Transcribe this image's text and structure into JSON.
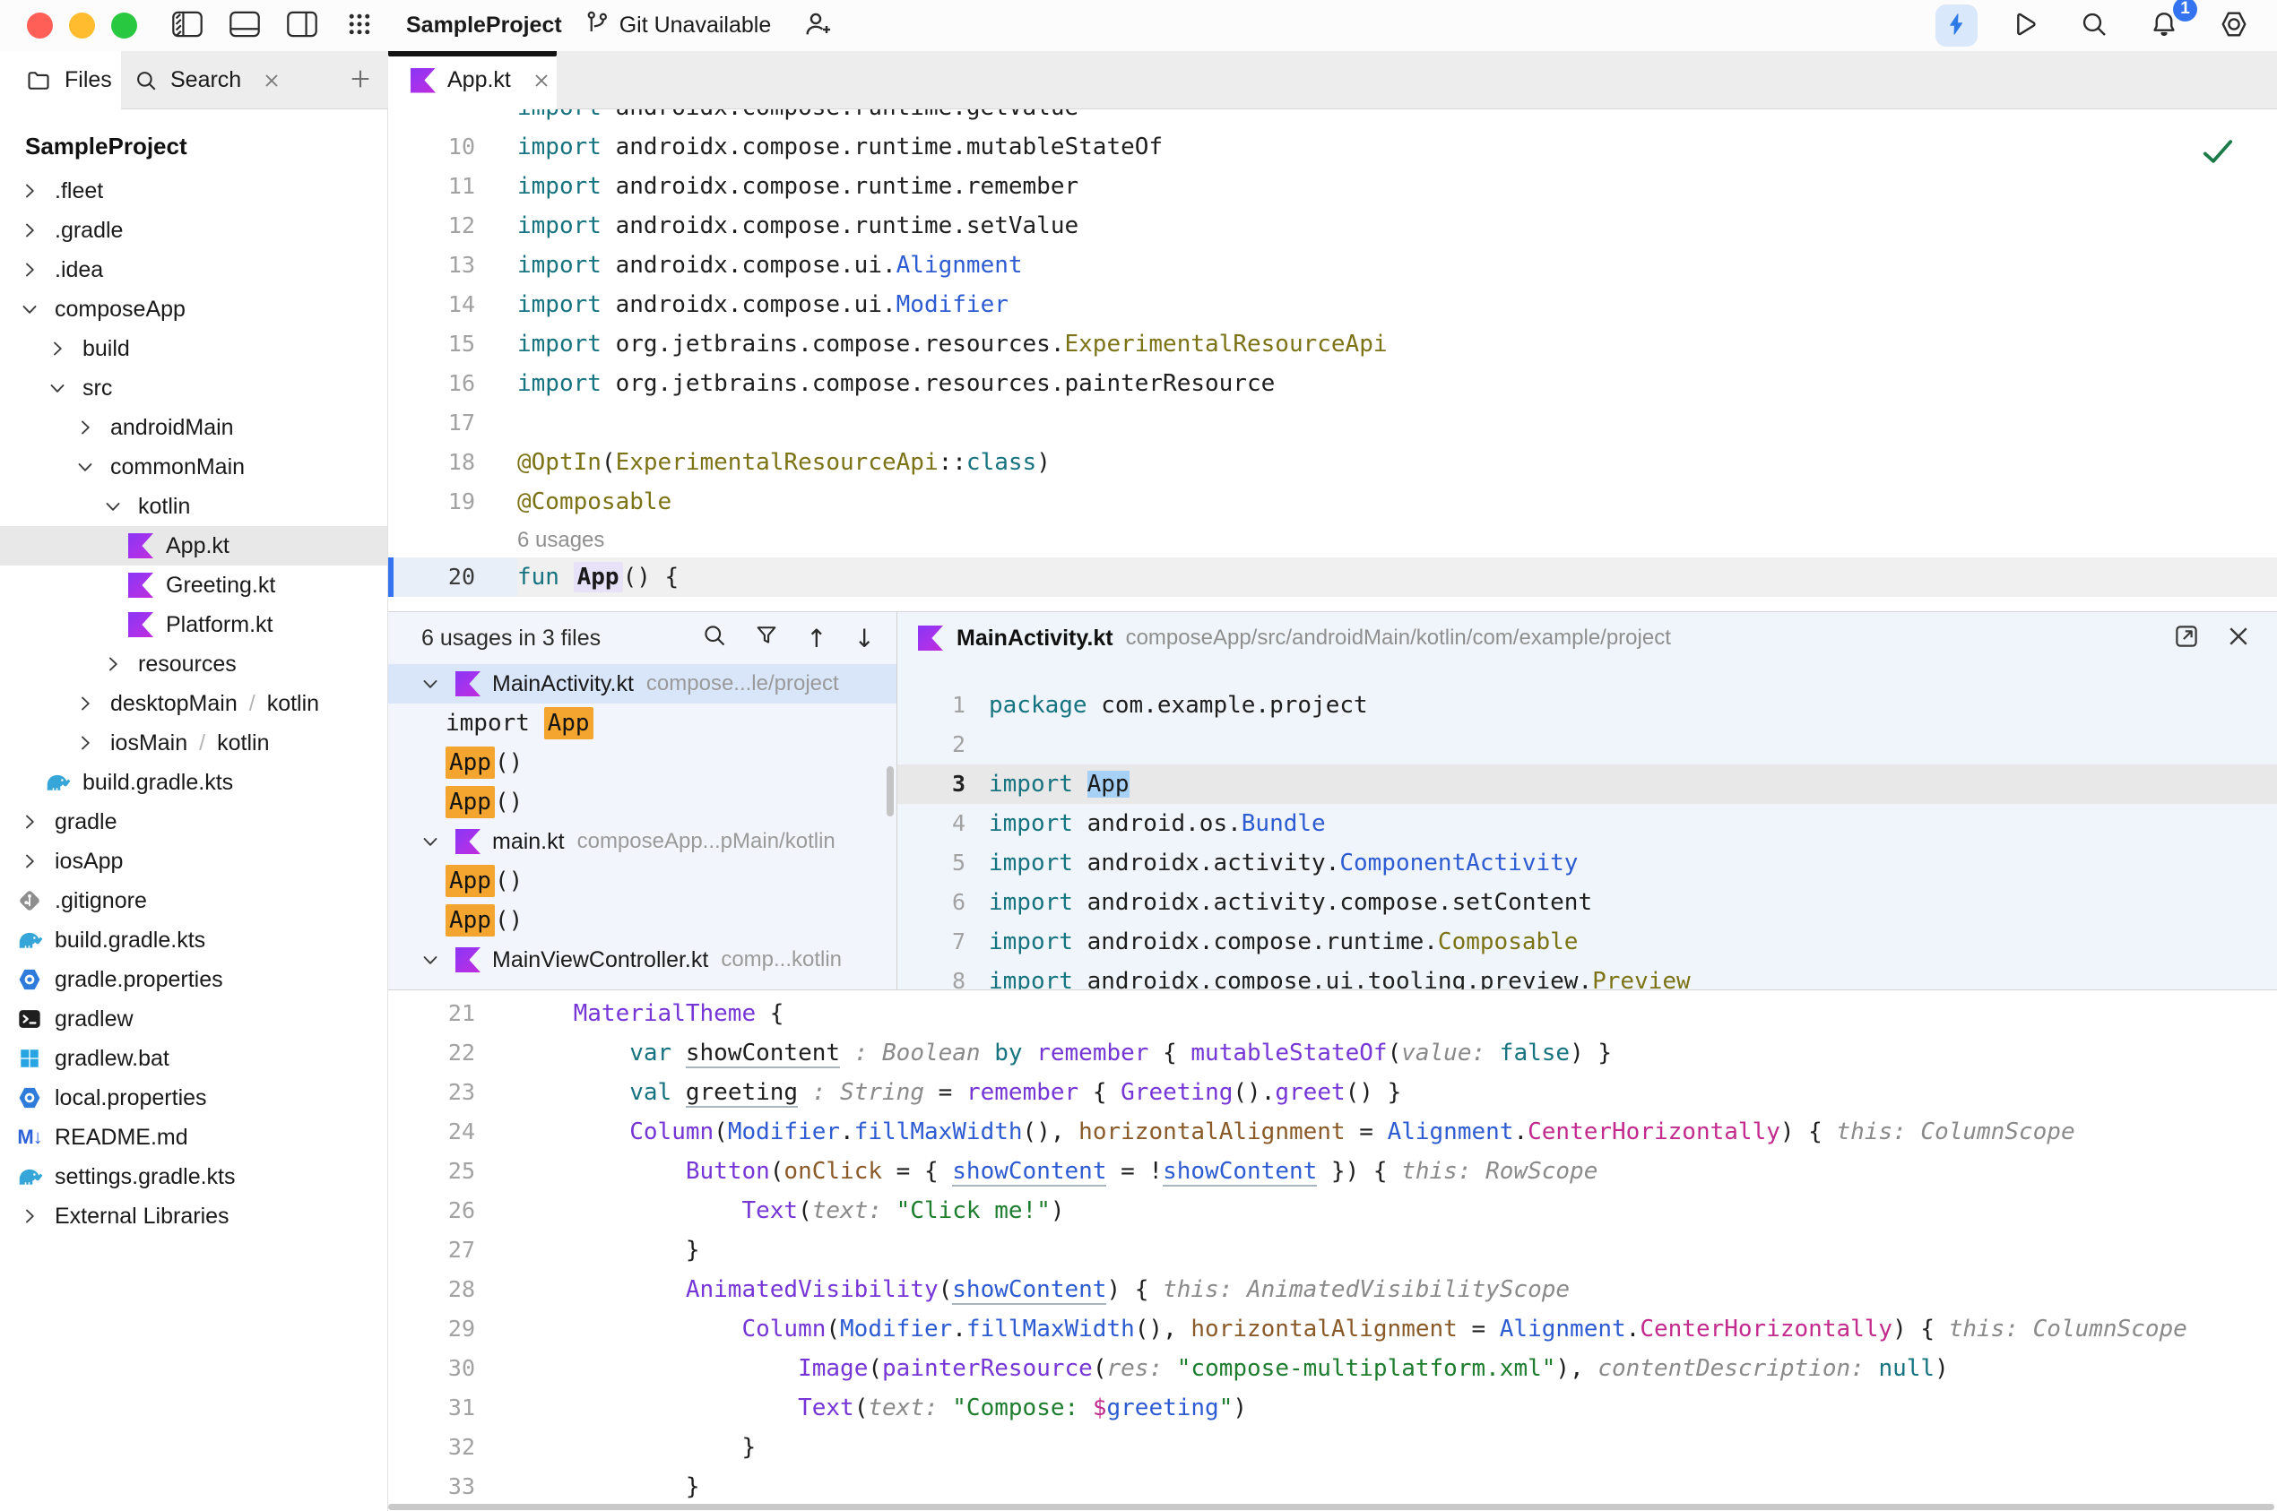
{
  "titlebar": {
    "project": "SampleProject",
    "git_status": "Git Unavailable",
    "notification_count": "1"
  },
  "sidebar": {
    "tabs": [
      {
        "label": "Files"
      },
      {
        "label": "Search"
      }
    ],
    "root": "SampleProject",
    "tree": [
      {
        "label": ".fleet",
        "indent": 0,
        "chevron": "right"
      },
      {
        "label": ".gradle",
        "indent": 0,
        "chevron": "right"
      },
      {
        "label": ".idea",
        "indent": 0,
        "chevron": "right"
      },
      {
        "label": "composeApp",
        "indent": 0,
        "chevron": "down"
      },
      {
        "label": "build",
        "indent": 1,
        "chevron": "right"
      },
      {
        "label": "src",
        "indent": 1,
        "chevron": "down"
      },
      {
        "label": "androidMain",
        "indent": 2,
        "chevron": "right"
      },
      {
        "label": "commonMain",
        "indent": 2,
        "chevron": "down"
      },
      {
        "label": "kotlin",
        "indent": 3,
        "chevron": "down"
      },
      {
        "label": "App.kt",
        "indent": 4,
        "icon": "kotlin",
        "selected": true
      },
      {
        "label": "Greeting.kt",
        "indent": 4,
        "icon": "kotlin"
      },
      {
        "label": "Platform.kt",
        "indent": 4,
        "icon": "kotlin"
      },
      {
        "label": "resources",
        "indent": 3,
        "chevron": "right"
      },
      {
        "label": "desktopMain",
        "suffix": "kotlin",
        "indent": 2,
        "chevron": "right"
      },
      {
        "label": "iosMain",
        "suffix": "kotlin",
        "indent": 2,
        "chevron": "right"
      },
      {
        "label": "build.gradle.kts",
        "indent": 1,
        "icon": "gradle"
      },
      {
        "label": "gradle",
        "indent": 0,
        "chevron": "right"
      },
      {
        "label": "iosApp",
        "indent": 0,
        "chevron": "right"
      },
      {
        "label": ".gitignore",
        "indent": 0,
        "icon": "git"
      },
      {
        "label": "build.gradle.kts",
        "indent": 0,
        "icon": "gradle"
      },
      {
        "label": "gradle.properties",
        "indent": 0,
        "icon": "properties"
      },
      {
        "label": "gradlew",
        "indent": 0,
        "icon": "terminal"
      },
      {
        "label": "gradlew.bat",
        "indent": 0,
        "icon": "windows"
      },
      {
        "label": "local.properties",
        "indent": 0,
        "icon": "properties"
      },
      {
        "label": "README.md",
        "indent": 0,
        "icon": "markdown"
      },
      {
        "label": "settings.gradle.kts",
        "indent": 0,
        "icon": "gradle"
      },
      {
        "label": "External Libraries",
        "indent": 0,
        "chevron": "right"
      }
    ]
  },
  "editor": {
    "tab_label": "App.kt",
    "top_lines": [
      {
        "n": "",
        "partial": true,
        "tokens": [
          {
            "t": "import",
            "s": "kw"
          },
          {
            "t": " androidx.compose.runtime.getValue",
            "s": "pl"
          }
        ]
      },
      {
        "n": "10",
        "tokens": [
          {
            "t": "import",
            "s": "kw"
          },
          {
            "t": " androidx.compose.runtime.mutableStateOf",
            "s": "pl"
          }
        ]
      },
      {
        "n": "11",
        "tokens": [
          {
            "t": "import",
            "s": "kw"
          },
          {
            "t": " androidx.compose.runtime.remember",
            "s": "pl"
          }
        ]
      },
      {
        "n": "12",
        "tokens": [
          {
            "t": "import",
            "s": "kw"
          },
          {
            "t": " androidx.compose.runtime.setValue",
            "s": "pl"
          }
        ]
      },
      {
        "n": "13",
        "tokens": [
          {
            "t": "import",
            "s": "kw"
          },
          {
            "t": " androidx.compose.ui.",
            "s": "pl"
          },
          {
            "t": "Alignment",
            "s": "cls"
          }
        ]
      },
      {
        "n": "14",
        "tokens": [
          {
            "t": "import",
            "s": "kw"
          },
          {
            "t": " androidx.compose.ui.",
            "s": "pl"
          },
          {
            "t": "Modifier",
            "s": "cls"
          }
        ]
      },
      {
        "n": "15",
        "tokens": [
          {
            "t": "import",
            "s": "kw"
          },
          {
            "t": " org.jetbrains.compose.resources.",
            "s": "pl"
          },
          {
            "t": "ExperimentalResourceApi",
            "s": "ann"
          }
        ]
      },
      {
        "n": "16",
        "tokens": [
          {
            "t": "import",
            "s": "kw"
          },
          {
            "t": " org.jetbrains.compose.resources.painterResource",
            "s": "pl"
          }
        ]
      },
      {
        "n": "17",
        "tokens": []
      },
      {
        "n": "18",
        "tokens": [
          {
            "t": "@OptIn",
            "s": "ann"
          },
          {
            "t": "(",
            "s": "pl"
          },
          {
            "t": "ExperimentalResourceApi",
            "s": "ann"
          },
          {
            "t": "::",
            "s": "pl"
          },
          {
            "t": "class",
            "s": "kw"
          },
          {
            "t": ")",
            "s": "pl"
          }
        ]
      },
      {
        "n": "19",
        "tokens": [
          {
            "t": "@Composable",
            "s": "ann"
          }
        ]
      },
      {
        "n": "20",
        "cur": true,
        "hint": "6 usages",
        "tokens": [
          {
            "t": "fun ",
            "s": "kw"
          },
          {
            "t": "App",
            "s": "hlapp"
          },
          {
            "t": "() {",
            "s": "pl"
          }
        ]
      }
    ],
    "bottom_lines": [
      {
        "n": "21",
        "tokens": [
          {
            "t": "    ",
            "s": "pl"
          },
          {
            "t": "MaterialTheme",
            "s": "fn"
          },
          {
            "t": " {",
            "s": "pl"
          }
        ]
      },
      {
        "n": "22",
        "tokens": [
          {
            "t": "        ",
            "s": "pl"
          },
          {
            "t": "var ",
            "s": "kw"
          },
          {
            "t": "showContent",
            "s": "decl"
          },
          {
            "t": " : Boolean ",
            "s": "hint"
          },
          {
            "t": "by ",
            "s": "kw"
          },
          {
            "t": "remember",
            "s": "fn"
          },
          {
            "t": " { ",
            "s": "pl"
          },
          {
            "t": "mutableStateOf",
            "s": "fn"
          },
          {
            "t": "(",
            "s": "pl"
          },
          {
            "t": "value: ",
            "s": "hint"
          },
          {
            "t": "false",
            "s": "kw"
          },
          {
            "t": ") }",
            "s": "pl"
          }
        ]
      },
      {
        "n": "23",
        "tokens": [
          {
            "t": "        ",
            "s": "pl"
          },
          {
            "t": "val ",
            "s": "kw"
          },
          {
            "t": "greeting",
            "s": "decl"
          },
          {
            "t": " : String ",
            "s": "hint"
          },
          {
            "t": "= ",
            "s": "pl"
          },
          {
            "t": "remember",
            "s": "fn"
          },
          {
            "t": " { ",
            "s": "pl"
          },
          {
            "t": "Greeting",
            "s": "fn"
          },
          {
            "t": "().",
            "s": "pl"
          },
          {
            "t": "greet",
            "s": "fn"
          },
          {
            "t": "() }",
            "s": "pl"
          }
        ]
      },
      {
        "n": "24",
        "tokens": [
          {
            "t": "        ",
            "s": "pl"
          },
          {
            "t": "Column",
            "s": "fn"
          },
          {
            "t": "(",
            "s": "pl"
          },
          {
            "t": "Modifier",
            "s": "cls"
          },
          {
            "t": ".",
            "s": "pl"
          },
          {
            "t": "fillMaxWidth",
            "s": "cls"
          },
          {
            "t": "(), ",
            "s": "pl"
          },
          {
            "t": "horizontalAlignment",
            "s": "param"
          },
          {
            "t": " = ",
            "s": "pl"
          },
          {
            "t": "Alignment",
            "s": "cls"
          },
          {
            "t": ".",
            "s": "pl"
          },
          {
            "t": "CenterHorizontally",
            "s": "prop"
          },
          {
            "t": ") { ",
            "s": "pl"
          },
          {
            "t": "this: ColumnScope",
            "s": "hint"
          }
        ]
      },
      {
        "n": "25",
        "tokens": [
          {
            "t": "            ",
            "s": "pl"
          },
          {
            "t": "Button",
            "s": "fn"
          },
          {
            "t": "(",
            "s": "pl"
          },
          {
            "t": "onClick",
            "s": "param"
          },
          {
            "t": " = { ",
            "s": "pl"
          },
          {
            "t": "showContent",
            "s": "varu"
          },
          {
            "t": " = !",
            "s": "pl"
          },
          {
            "t": "showContent",
            "s": "varu"
          },
          {
            "t": " }) { ",
            "s": "pl"
          },
          {
            "t": "this: RowScope",
            "s": "hint"
          }
        ]
      },
      {
        "n": "26",
        "tokens": [
          {
            "t": "                ",
            "s": "pl"
          },
          {
            "t": "Text",
            "s": "fn"
          },
          {
            "t": "(",
            "s": "pl"
          },
          {
            "t": "text: ",
            "s": "hint"
          },
          {
            "t": "\"Click me!\"",
            "s": "str"
          },
          {
            "t": ")",
            "s": "pl"
          }
        ]
      },
      {
        "n": "27",
        "tokens": [
          {
            "t": "            }",
            "s": "pl"
          }
        ]
      },
      {
        "n": "28",
        "tokens": [
          {
            "t": "            ",
            "s": "pl"
          },
          {
            "t": "AnimatedVisibility",
            "s": "fn"
          },
          {
            "t": "(",
            "s": "pl"
          },
          {
            "t": "showContent",
            "s": "varu"
          },
          {
            "t": ") { ",
            "s": "pl"
          },
          {
            "t": "this: AnimatedVisibilityScope",
            "s": "hint"
          }
        ]
      },
      {
        "n": "29",
        "tokens": [
          {
            "t": "                ",
            "s": "pl"
          },
          {
            "t": "Column",
            "s": "fn"
          },
          {
            "t": "(",
            "s": "pl"
          },
          {
            "t": "Modifier",
            "s": "cls"
          },
          {
            "t": ".",
            "s": "pl"
          },
          {
            "t": "fillMaxWidth",
            "s": "cls"
          },
          {
            "t": "(), ",
            "s": "pl"
          },
          {
            "t": "horizontalAlignment",
            "s": "param"
          },
          {
            "t": " = ",
            "s": "pl"
          },
          {
            "t": "Alignment",
            "s": "cls"
          },
          {
            "t": ".",
            "s": "pl"
          },
          {
            "t": "CenterHorizontally",
            "s": "prop"
          },
          {
            "t": ") { ",
            "s": "pl"
          },
          {
            "t": "this: ColumnScope",
            "s": "hint"
          }
        ]
      },
      {
        "n": "30",
        "tokens": [
          {
            "t": "                    ",
            "s": "pl"
          },
          {
            "t": "Image",
            "s": "fn"
          },
          {
            "t": "(",
            "s": "pl"
          },
          {
            "t": "painterResource",
            "s": "fn"
          },
          {
            "t": "(",
            "s": "pl"
          },
          {
            "t": "res: ",
            "s": "hint"
          },
          {
            "t": "\"compose-multiplatform.xml\"",
            "s": "str"
          },
          {
            "t": "), ",
            "s": "pl"
          },
          {
            "t": "contentDescription: ",
            "s": "hint"
          },
          {
            "t": "null",
            "s": "kw"
          },
          {
            "t": ")",
            "s": "pl"
          }
        ]
      },
      {
        "n": "31",
        "tokens": [
          {
            "t": "                    ",
            "s": "pl"
          },
          {
            "t": "Text",
            "s": "fn"
          },
          {
            "t": "(",
            "s": "pl"
          },
          {
            "t": "text: ",
            "s": "hint"
          },
          {
            "t": "\"Compose: ",
            "s": "str"
          },
          {
            "t": "$",
            "s": "prop"
          },
          {
            "t": "greeting",
            "s": "ref"
          },
          {
            "t": "\"",
            "s": "str"
          },
          {
            "t": ")",
            "s": "pl"
          }
        ]
      },
      {
        "n": "32",
        "tokens": [
          {
            "t": "                }",
            "s": "pl"
          }
        ]
      },
      {
        "n": "33",
        "tokens": [
          {
            "t": "            }",
            "s": "pl"
          }
        ]
      }
    ]
  },
  "usages": {
    "title": "6 usages in 3 files",
    "rows": [
      {
        "type": "group",
        "file": "MainActivity.kt",
        "path": "compose...le/project",
        "selected": true
      },
      {
        "type": "usage",
        "tokens": [
          {
            "t": "import ",
            "s": "pl"
          },
          {
            "t": "App",
            "s": "hl"
          }
        ]
      },
      {
        "type": "usage",
        "tokens": [
          {
            "t": "App",
            "s": "hl"
          },
          {
            "t": "()",
            "s": "pl"
          }
        ]
      },
      {
        "type": "usage",
        "tokens": [
          {
            "t": "App",
            "s": "hl"
          },
          {
            "t": "()",
            "s": "pl"
          }
        ]
      },
      {
        "type": "group",
        "file": "main.kt",
        "path": "composeApp...pMain/kotlin"
      },
      {
        "type": "usage",
        "tokens": [
          {
            "t": "App",
            "s": "hl"
          },
          {
            "t": "()",
            "s": "pl"
          }
        ]
      },
      {
        "type": "usage",
        "tokens": [
          {
            "t": "App",
            "s": "hl"
          },
          {
            "t": "()",
            "s": "pl"
          }
        ]
      },
      {
        "type": "group",
        "file": "MainViewController.kt",
        "path": "comp...kotlin"
      }
    ]
  },
  "preview": {
    "file": "MainActivity.kt",
    "path": "composeApp/src/androidMain/kotlin/com/example/project",
    "lines": [
      {
        "n": "1",
        "tokens": [
          {
            "t": "package ",
            "s": "kw"
          },
          {
            "t": "com.example.project",
            "s": "pl"
          }
        ]
      },
      {
        "n": "2",
        "tokens": []
      },
      {
        "n": "3",
        "cur": true,
        "tokens": [
          {
            "t": "import ",
            "s": "kw"
          },
          {
            "t": "App",
            "s": "sel"
          }
        ]
      },
      {
        "n": "4",
        "tokens": [
          {
            "t": "import ",
            "s": "kw"
          },
          {
            "t": "android.os.",
            "s": "pl"
          },
          {
            "t": "Bundle",
            "s": "cls"
          }
        ]
      },
      {
        "n": "5",
        "tokens": [
          {
            "t": "import ",
            "s": "kw"
          },
          {
            "t": "androidx.activity.",
            "s": "pl"
          },
          {
            "t": "ComponentActivity",
            "s": "cls"
          }
        ]
      },
      {
        "n": "6",
        "tokens": [
          {
            "t": "import ",
            "s": "kw"
          },
          {
            "t": "androidx.activity.compose.setContent",
            "s": "pl"
          }
        ]
      },
      {
        "n": "7",
        "tokens": [
          {
            "t": "import ",
            "s": "kw"
          },
          {
            "t": "androidx.compose.runtime.",
            "s": "pl"
          },
          {
            "t": "Composable",
            "s": "ann"
          }
        ]
      },
      {
        "n": "8",
        "tokens": [
          {
            "t": "import ",
            "s": "kw"
          },
          {
            "t": "androidx.compose.ui.tooling.preview.",
            "s": "pl"
          },
          {
            "t": "Preview",
            "s": "ann"
          }
        ]
      }
    ]
  }
}
